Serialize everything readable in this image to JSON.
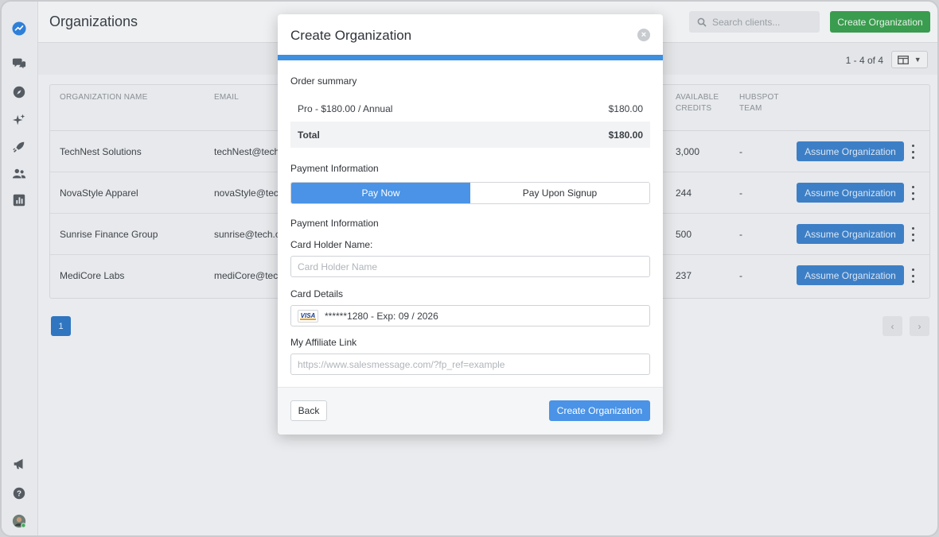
{
  "header": {
    "title": "Organizations",
    "search_placeholder": "Search clients...",
    "create_button": "Create Organization"
  },
  "toolbar": {
    "range": "1 - 4 of 4"
  },
  "table": {
    "columns": [
      "ORGANIZATION NAME",
      "EMAIL",
      "AVAILABLE CREDITS",
      "HUBSPOT TEAM"
    ],
    "rows": [
      {
        "name": "TechNest Solutions",
        "email": "techNest@tech",
        "credits": "3,000",
        "hubspot": "-"
      },
      {
        "name": "NovaStyle Apparel",
        "email": "novaStyle@tec",
        "credits": "244",
        "hubspot": "-"
      },
      {
        "name": "Sunrise Finance Group",
        "email": "sunrise@tech.c",
        "credits": "500",
        "hubspot": "-"
      },
      {
        "name": "MediCore Labs",
        "email": "mediCore@tech",
        "credits": "237",
        "hubspot": "-"
      }
    ],
    "row_action": "Assume Organization"
  },
  "pagination": {
    "page": "1"
  },
  "modal": {
    "title": "Create Organization",
    "order_summary_label": "Order summary",
    "line_item": {
      "label": "Pro - $180.00 / Annual",
      "amount": "$180.00"
    },
    "total": {
      "label": "Total",
      "amount": "$180.00"
    },
    "payment_info_label": "Payment Information",
    "tabs": [
      "Pay Now",
      "Pay Upon Signup"
    ],
    "payment_info_label_2": "Payment Information",
    "card_holder_label": "Card Holder Name:",
    "card_holder_placeholder": "Card Holder Name",
    "card_details_label": "Card Details",
    "card_brand": "VISA",
    "card_value": "******1280 - Exp: 09 / 2026",
    "affiliate_label": "My Affiliate Link",
    "affiliate_placeholder": "https://www.salesmessage.com/?fp_ref=example",
    "back_button": "Back",
    "create_button": "Create Organization"
  },
  "colors": {
    "accent_blue": "#4a93e6",
    "brand_green": "#3a9c4e",
    "action_blue": "#3d7fc6"
  }
}
